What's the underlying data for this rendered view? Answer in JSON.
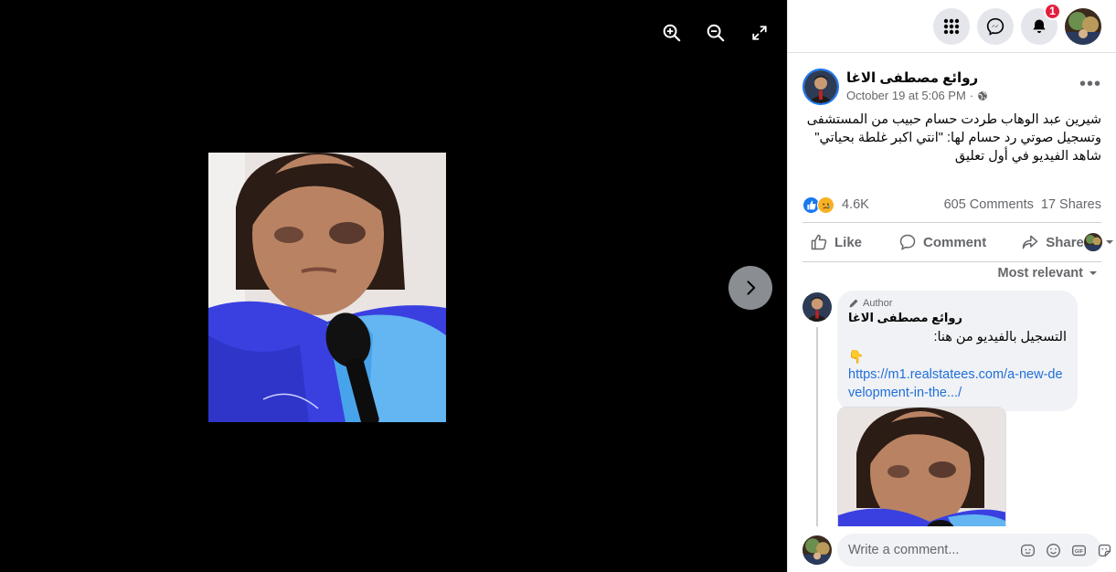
{
  "viewer": {
    "tools": [
      {
        "icon": "zoom-in-icon"
      },
      {
        "icon": "zoom-out-icon"
      },
      {
        "icon": "fullscreen-icon"
      }
    ],
    "next_icon": "chevron-right-icon"
  },
  "topbar": {
    "notifications_badge": "1"
  },
  "post": {
    "author": "روائع مصطفى الاغا",
    "date": "October 19 at 5:06 PM",
    "separator": "·",
    "more": "•••",
    "text_lines": [
      "شيرين عبد الوهاب طردت حسام حبيب من المستشفى",
      "وتسجيل صوتي رد حسام لها: \"انتي اكبر غلطة بحياتي\"",
      "شاهد الفيديو في أول تعليق"
    ],
    "reactions_count": "4.6K",
    "comments_count": "605 Comments",
    "shares_count": "17 Shares"
  },
  "actions": {
    "like": "Like",
    "comment": "Comment",
    "share": "Share"
  },
  "sort_label": "Most relevant",
  "comment": {
    "author_tag": "Author",
    "author": "روائع مصطفى الاغا",
    "text": "التسجيل بالفيديو من هنا:",
    "emoji": "👇",
    "link": "https://m1.realstatees.com/a-new-development-in-the.../"
  },
  "composer": {
    "placeholder": "Write a comment..."
  },
  "colors": {
    "accent": "#1877f2",
    "badge": "#e41e3f",
    "link": "#216fdb",
    "muted": "#65676b"
  }
}
